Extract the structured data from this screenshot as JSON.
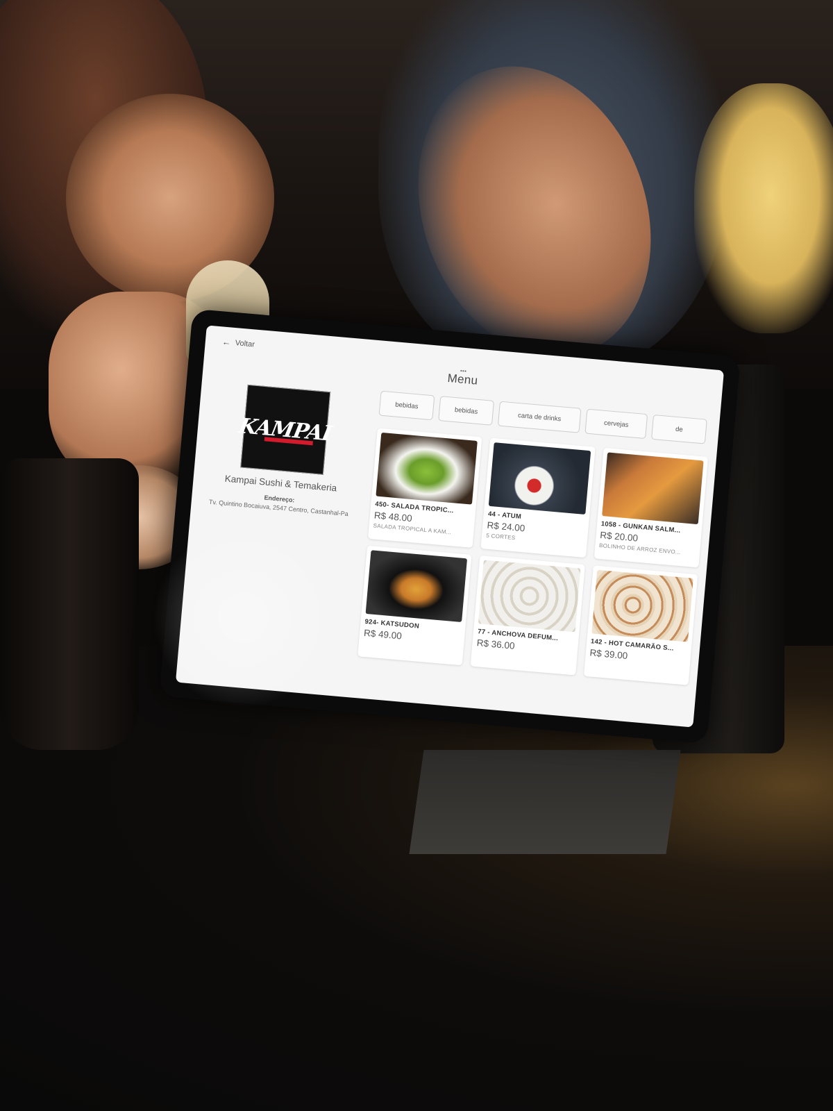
{
  "header": {
    "back_label": "Voltar",
    "title": "Menu"
  },
  "restaurant": {
    "logo_text": "KAMPAI",
    "name": "Kampai Sushi & Temakeria",
    "address_label": "Endereço:",
    "address": "Tv. Quintino Bocaiuva, 2547 Centro, Castanhal-Pa"
  },
  "tabs": [
    {
      "label": "bebidas"
    },
    {
      "label": "bebidas"
    },
    {
      "label": "carta de drinks"
    },
    {
      "label": "cervejas"
    },
    {
      "label": "de"
    }
  ],
  "products": [
    {
      "title": "450- SALADA TROPIC...",
      "price": "R$ 48.00",
      "desc": "SALADA TROPICAL A KAM...",
      "image": "salada-image"
    },
    {
      "title": "44 - ATUM",
      "price": "R$ 24.00",
      "desc": "5 CORTES",
      "image": "atum-image"
    },
    {
      "title": "1058 - GUNKAN SALM...",
      "price": "R$ 20.00",
      "desc": "BOLINHO DE ARROZ ENVO...",
      "image": "gunkan-image"
    },
    {
      "title": "924- KATSUDON",
      "price": "R$ 49.00",
      "desc": "",
      "image": "katsudon-image"
    },
    {
      "title": "77 - ANCHOVA DEFUM...",
      "price": "R$ 36.00",
      "desc": "",
      "image": "anchova-image"
    },
    {
      "title": "142 - HOT CAMARÃO S...",
      "price": "R$ 39.00",
      "desc": "",
      "image": "hot-camarao-image"
    }
  ],
  "icons": {
    "back": "arrow-left-icon",
    "menu_dots": "drag-dots-icon"
  },
  "colors": {
    "screen_bg": "#f5f5f6",
    "logo_bg": "#111111",
    "logo_accent": "#d21b2c"
  }
}
